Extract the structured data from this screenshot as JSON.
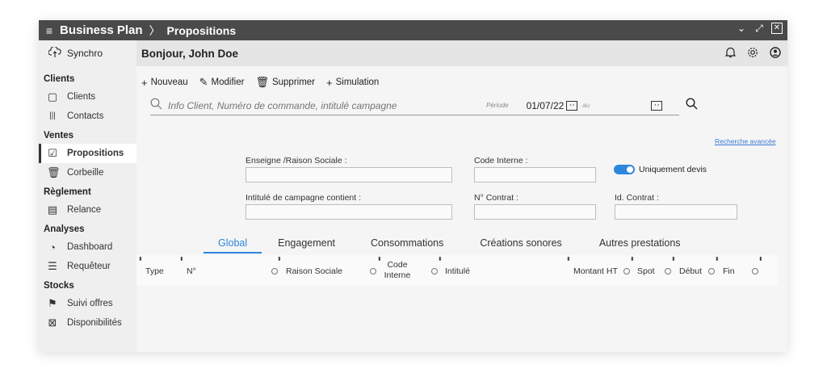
{
  "titlebar": {
    "menu_icon": "hamburger-icon",
    "app_name": "Business Plan",
    "separator": "〉",
    "crumb": "Propositions"
  },
  "topbar": {
    "greeting": "Bonjour, John Doe",
    "icons": [
      "bell-icon",
      "gear-icon",
      "user-icon"
    ]
  },
  "sidebar": {
    "synchro": "Synchro",
    "sections": [
      {
        "title": "Clients",
        "items": [
          {
            "label": "Clients",
            "icon": "document-icon"
          },
          {
            "label": "Contacts",
            "icon": "users-icon"
          }
        ]
      },
      {
        "title": "Ventes",
        "items": [
          {
            "label": "Propositions",
            "icon": "clipboard-check-icon",
            "active": true
          },
          {
            "label": "Corbeille",
            "icon": "trash-icon"
          }
        ]
      },
      {
        "title": "Règlement",
        "items": [
          {
            "label": "Relance",
            "icon": "list-icon"
          }
        ]
      },
      {
        "title": "Analyses",
        "items": [
          {
            "label": "Dashboard",
            "icon": "dashboard-icon"
          },
          {
            "label": "Requêteur",
            "icon": "sliders-icon"
          }
        ]
      },
      {
        "title": "Stocks",
        "items": [
          {
            "label": "Suivi offres",
            "icon": "signpost-icon"
          },
          {
            "label": "Disponibilités",
            "icon": "calendar-x-icon"
          }
        ]
      }
    ]
  },
  "toolbar": {
    "new_label": "Nouveau",
    "edit_label": "Modifier",
    "delete_label": "Supprimer",
    "simulation_label": "Simulation"
  },
  "search": {
    "placeholder": "Info Client, Numéro de commande, intitulé campagne",
    "periode_label": "Période",
    "date_from": "01/07/22",
    "au_label": "au",
    "advanced_link": "Recherche avancée"
  },
  "form": {
    "enseigne_label": "Enseigne /Raison Sociale :",
    "code_interne_label": "Code Interne :",
    "uniquement_devis_label": "Uniquement devis",
    "uniquement_devis_on": true,
    "intitule_label": "Intitulé de campagne contient :",
    "contrat_label": "N° Contrat :",
    "id_contrat_label": "Id. Contrat :"
  },
  "tabs": [
    "Global",
    "Engagement",
    "Consommations",
    "Créations sonores",
    "Autres prestations"
  ],
  "active_tab": "Global",
  "table": {
    "columns": [
      "Type",
      "N°",
      "Raison Sociale",
      "Code Interne",
      "Intitulé",
      "Montant HT",
      "Spot",
      "Début",
      "Fin"
    ]
  },
  "colors": {
    "accent": "#2f86de",
    "titlebar": "#4a4a4a",
    "sidebar": "#efefef"
  }
}
